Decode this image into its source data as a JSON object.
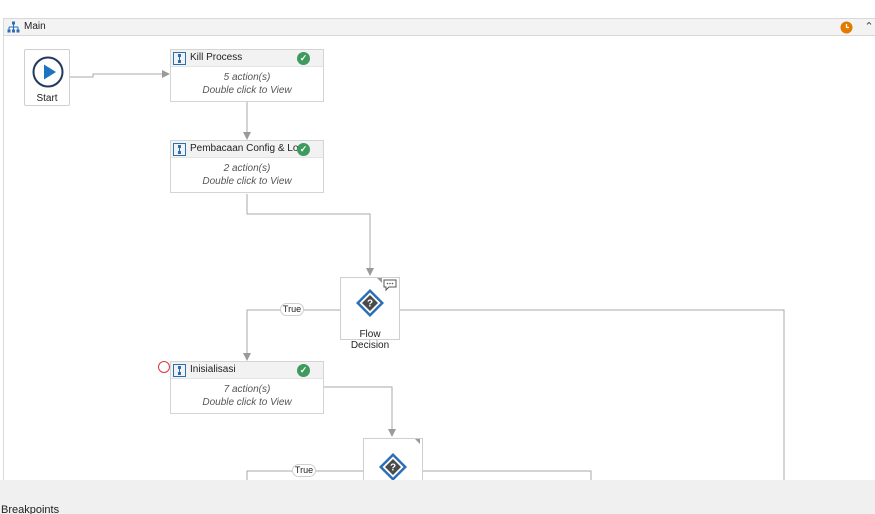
{
  "header": {
    "title": "Main"
  },
  "start": {
    "label": "Start"
  },
  "activities": [
    {
      "title": "Kill Process",
      "line1": "5 action(s)",
      "line2": "Double click to View"
    },
    {
      "title": "Pembacaan Config & Logi",
      "line1": "2 action(s)",
      "line2": "Double click to View"
    },
    {
      "title": "Inisialisasi",
      "line1": "7 action(s)",
      "line2": "Double click to View"
    }
  ],
  "decisions": [
    {
      "label": "Flow Decision",
      "true_label": "True"
    },
    {
      "label": "",
      "true_label": "True"
    }
  ],
  "bottom_panel": {
    "tab": "Breakpoints"
  },
  "colors": {
    "accent_blue": "#1e73be",
    "status_green": "#3e9a5d",
    "warning_orange": "#e07b00",
    "breakpoint_red": "#d9363e"
  }
}
